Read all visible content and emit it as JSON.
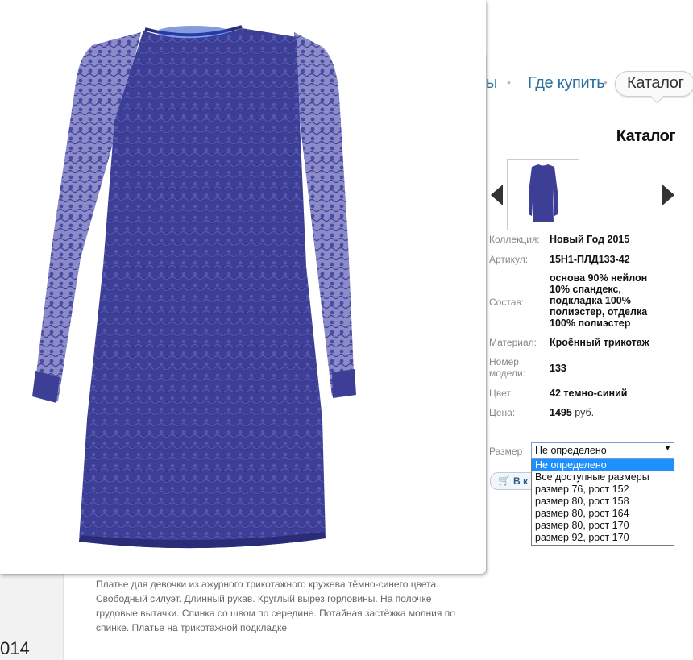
{
  "nav": {
    "fragment": "ы",
    "where_to_buy": "Где купить",
    "catalog": "Каталог"
  },
  "page": {
    "section_title": "Каталог",
    "year_fragment": "014"
  },
  "product": {
    "thumbnail": "blue-lace-dress-thumbnail",
    "properties": [
      {
        "label": "Коллекция:",
        "value": "Новый Год 2015"
      },
      {
        "label": "Артикул:",
        "value": "15Н1-ПЛД133-42"
      },
      {
        "label": "Состав:",
        "value": "основа 90% нейлон 10% спандекс, подкладка 100% полиэстер, отделка 100% полиэстер"
      },
      {
        "label": "Материал:",
        "value": "Кроённый трикотаж"
      },
      {
        "label": "Номер модели:",
        "value": "133"
      },
      {
        "label": "Цвет:",
        "value": "42 темно-синий"
      },
      {
        "label": "Цена:",
        "value": "1495",
        "unit": "руб."
      }
    ],
    "size": {
      "label": "Размер",
      "selected": "Не определено",
      "options": [
        "Не определено",
        "Все доступные размеры",
        "размер 76, рост 152",
        "размер 80, рост 158",
        "размер 80, рост 164",
        "размер 80, рост 170",
        "размер 92, рост 170"
      ]
    },
    "cart_button": "В к",
    "description": "Платье для девочки из ажурного трикотажного кружева тёмно-синего цвета. Свободный силуэт. Длинный рукав. Круглый вырез горловины. На полочке грудовые вытачки. Спинка со швом по середине. Потайная застёжка молния по спинке. Платье на трикотажной подкладке"
  },
  "colors": {
    "dress": "#3d3f96",
    "link": "#2a6f9e",
    "dropdown_highlight": "#1e90ff"
  }
}
